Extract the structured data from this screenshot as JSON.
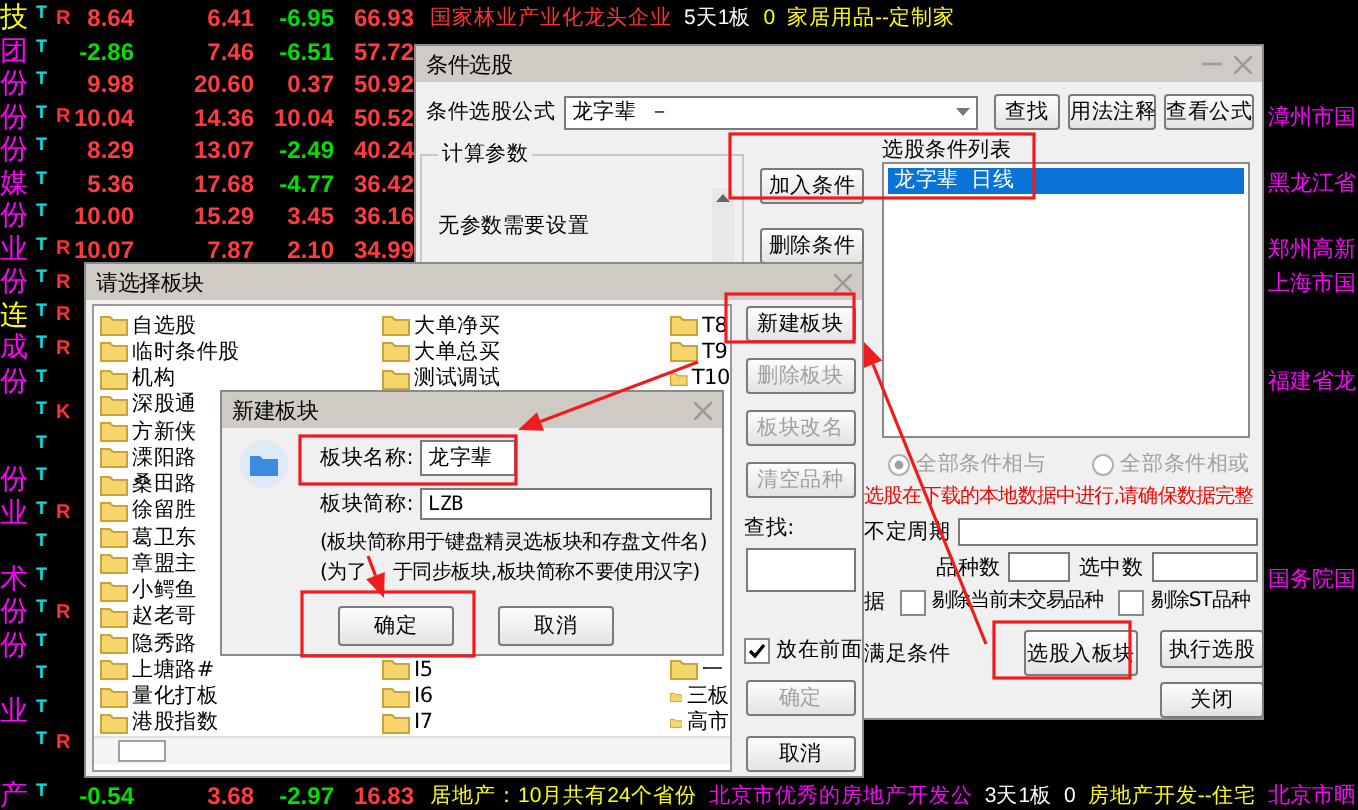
{
  "quote_rows": [
    {
      "name": {
        "text": "技",
        "color": "#ffff00"
      },
      "tag": "T",
      "flag": "R",
      "nums": [
        "8.64",
        "6.41",
        "-6.95",
        "66.93"
      ],
      "mid": [
        {
          "text": "国家林业产业化龙头企业",
          "color": "#ff3030"
        },
        {
          "text": "5天1板",
          "color": "#ffffff"
        },
        {
          "text": "0",
          "color": "#ffff00"
        },
        {
          "text": "家居用品--定制家",
          "color": "#ffff00"
        }
      ]
    },
    {
      "name": {
        "text": "团",
        "color": "#ff00ff"
      },
      "tag": "T",
      "nums": [
        "-2.86",
        "7.46",
        "-6.51",
        "57.72"
      ]
    },
    {
      "name": {
        "text": "份",
        "color": "#ff00ff"
      },
      "tag": "T",
      "nums": [
        "9.98",
        "20.60",
        "0.37",
        "50.92"
      ]
    },
    {
      "name": {
        "text": "份",
        "color": "#ff00ff"
      },
      "tag": "T",
      "flag": "R",
      "nums": [
        "10.04",
        "14.36",
        "10.04",
        "50.52"
      ],
      "edge": "漳州市国"
    },
    {
      "name": {
        "text": "份",
        "color": "#ff00ff"
      },
      "tag": "T",
      "nums": [
        "8.29",
        "13.07",
        "-2.49",
        "40.24"
      ]
    },
    {
      "name": {
        "text": "媒",
        "color": "#ff00ff"
      },
      "tag": "T",
      "nums": [
        "5.36",
        "17.68",
        "-4.77",
        "36.42"
      ],
      "edge": "黑龙江省"
    },
    {
      "name": {
        "text": "份",
        "color": "#ff00ff"
      },
      "tag": "T",
      "nums": [
        "10.00",
        "15.29",
        "3.45",
        "36.16"
      ]
    },
    {
      "name": {
        "text": "业",
        "color": "#ff00ff"
      },
      "tag": "T",
      "flag": "R",
      "nums": [
        "10.07",
        "7.87",
        "2.10",
        "34.99"
      ],
      "edge": "郑州高新"
    },
    {
      "name": {
        "text": "份",
        "color": "#ff00ff"
      },
      "tag": "T",
      "flag": "R",
      "edge": "上海市国"
    },
    {
      "name": {
        "text": "连",
        "color": "#ffff00"
      },
      "tag": "T",
      "flag": "R"
    },
    {
      "name": {
        "text": "成",
        "color": "#ff00ff"
      },
      "tag": "T",
      "flag": "R"
    },
    {
      "name": {
        "text": "份",
        "color": "#ff00ff"
      },
      "tag": "T",
      "edge": "福建省龙"
    },
    {
      "tag": "T",
      "flag": "K"
    },
    {
      "tag": "T"
    },
    {
      "name": {
        "text": "份",
        "color": "#ff00ff"
      },
      "tag": "T"
    },
    {
      "name": {
        "text": "业",
        "color": "#ff00ff"
      },
      "tag": "T",
      "flag": "R"
    },
    {
      "tag": "T"
    },
    {
      "name": {
        "text": "术",
        "color": "#ff00ff"
      },
      "tag": "T",
      "edge": "国务院国"
    },
    {
      "name": {
        "text": "份",
        "color": "#ff00ff"
      },
      "tag": "T",
      "flag": "R"
    },
    {
      "name": {
        "text": "份",
        "color": "#ff00ff"
      },
      "tag": "T"
    },
    {
      "tag": "T"
    },
    {
      "name": {
        "text": "业",
        "color": "#ff00ff"
      },
      "tag": "T"
    },
    {
      "tag": "T",
      "flag": "R"
    },
    {
      "name": {
        "text": "产",
        "color": "#ff00ff"
      },
      "tag": "T",
      "nums": [
        "-0.54",
        "3.68",
        "-2.97",
        "16.83"
      ],
      "mid": [
        {
          "text": "居地产：10月共有24个省份",
          "color": "#ffff00"
        },
        {
          "text": "北京市优秀的房地产开发公",
          "color": "#ff00ff"
        },
        {
          "text": "3天1板",
          "color": "#ffffff"
        },
        {
          "text": "0",
          "color": "#ffffff"
        },
        {
          "text": "房地产开发--住宅",
          "color": "#ffff00"
        }
      ],
      "edge": "北京市晒"
    }
  ],
  "condition_dialog": {
    "title": "条件选股",
    "formula_label": "条件选股公式",
    "formula_value": "龙字辈  －",
    "top_buttons": [
      "查找",
      "用法注释",
      "查看公式"
    ],
    "params_group": "计算参数",
    "params_text": "无参数需要设置",
    "add_button": "加入条件",
    "delete_button": "删除条件",
    "list_label": "选股条件列表",
    "conditions": [
      {
        "text": "龙字辈  日线",
        "selected": true
      }
    ],
    "logic_options": [
      {
        "label": "全部条件相与",
        "selected": true,
        "disabled": true
      },
      {
        "label": "全部条件相或",
        "selected": false,
        "disabled": true
      }
    ],
    "notice": "选股在下载的本地数据中进行,请确保数据完整",
    "period_label": "不定周期",
    "count_label": "品种数",
    "selected_count_label": "选中数",
    "data_label": "据",
    "exclusions": [
      {
        "label": "剔除当前未交易品种",
        "checked": false
      },
      {
        "label": "剔除ST品种",
        "checked": false
      }
    ],
    "satisfy_label": "满足条件",
    "to_block_button": "选股入板块",
    "run_button": "执行选股",
    "close_button": "关闭"
  },
  "block_dialog": {
    "title": "请选择板块",
    "folder_columns": [
      {
        "top": [
          "自选股",
          "临时条件股",
          "机构",
          "深股通",
          "方新侠",
          "溧阳路",
          "桑田路",
          "徐留胜",
          "葛卫东",
          "章盟主",
          "小鳄鱼",
          "赵老哥",
          "隐秀路",
          "上塘路#",
          "量化打板",
          "港股指数"
        ]
      },
      {
        "top": [
          "大单净买",
          "大单总买",
          "测试调试"
        ],
        "bottom": [
          "I5",
          "I6",
          "I7"
        ]
      },
      {
        "top": [
          "T8",
          "T9",
          "T10"
        ],
        "bottom": [
          "一",
          "三板",
          "高市"
        ]
      }
    ],
    "buttons": [
      {
        "label": "新建板块",
        "disabled": false
      },
      {
        "label": "删除板块",
        "disabled": true
      },
      {
        "label": "板块改名",
        "disabled": true
      },
      {
        "label": "清空品种",
        "disabled": true
      }
    ],
    "search_label": "查找:",
    "front_option": {
      "label": "放在前面",
      "checked": true
    },
    "ok_button": {
      "label": "确定",
      "disabled": true
    },
    "cancel_button": {
      "label": "取消",
      "disabled": false
    }
  },
  "new_block_dialog": {
    "title": "新建板块",
    "name_label": "板块名称:",
    "name_value": "龙字辈",
    "short_label": "板块简称:",
    "short_value": "LZB",
    "notes": [
      [
        "(板块简称用于键盘精灵选板块和存盘文件名)"
      ],
      [
        "(为了",
        "于同步板块,板块简称不要使用汉字)"
      ]
    ],
    "ok_button": "确定",
    "cancel_button": "取消"
  }
}
